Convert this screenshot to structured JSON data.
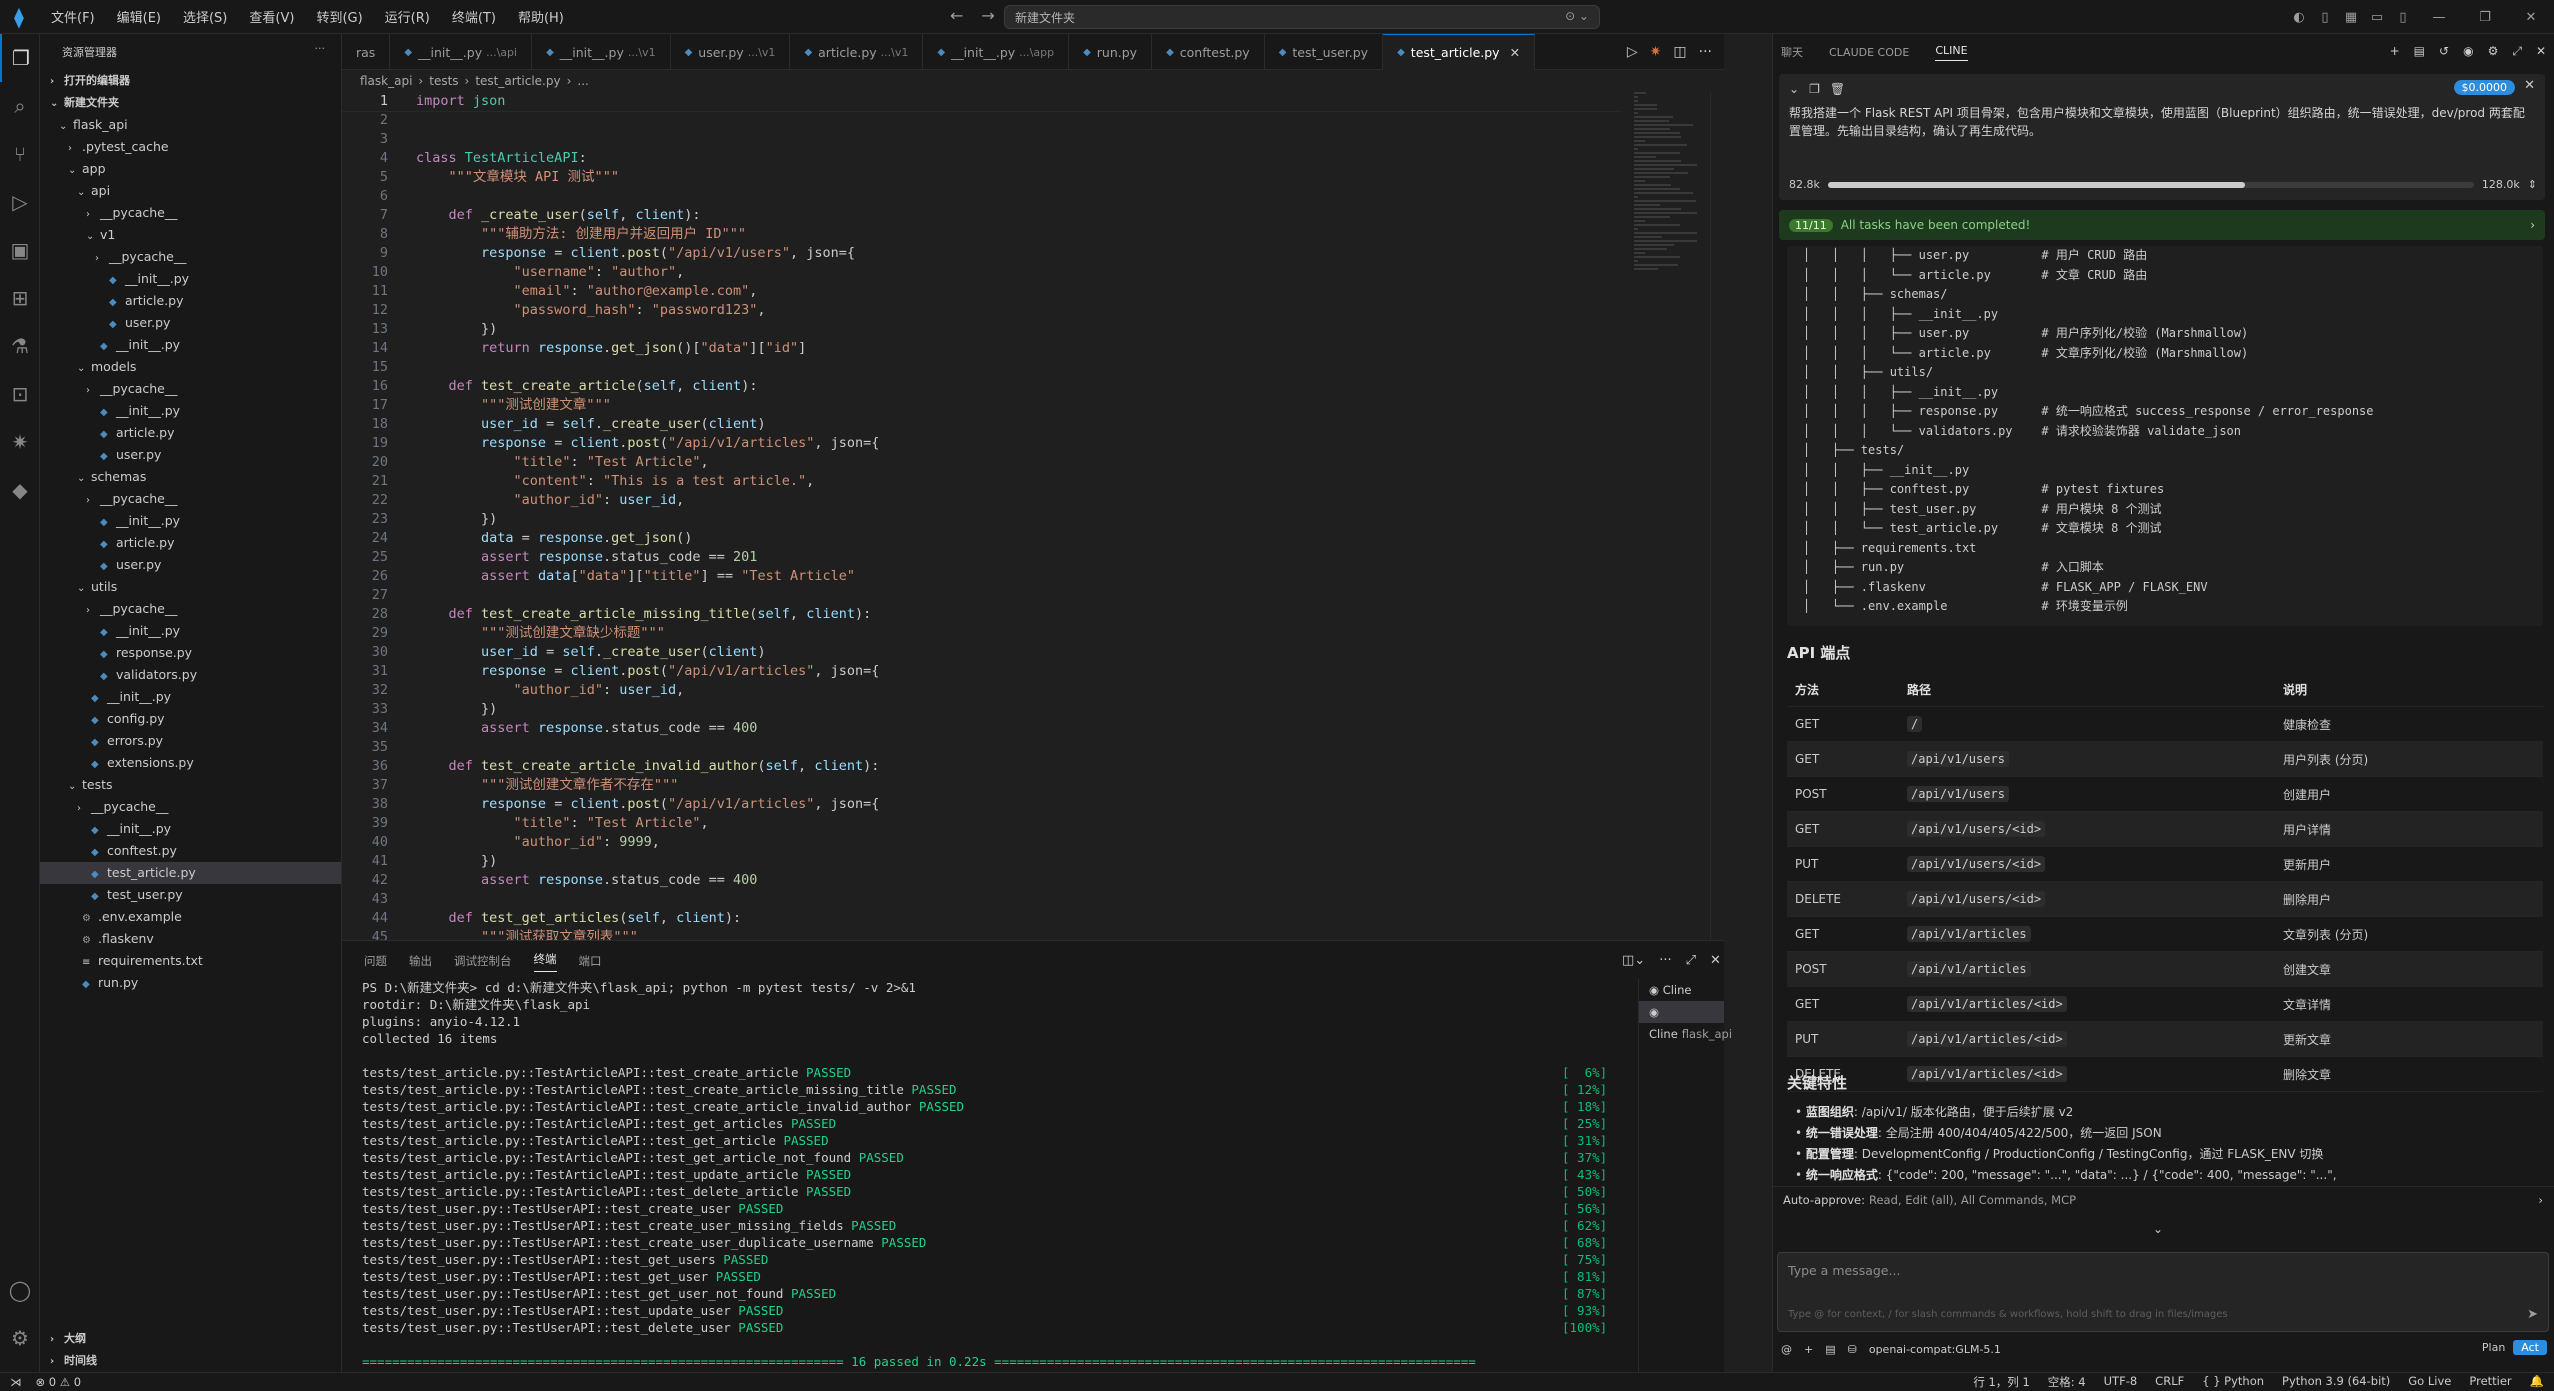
{
  "titlebar": {
    "menu": [
      "文件(F)",
      "编辑(E)",
      "选择(S)",
      "查看(V)",
      "转到(G)",
      "运行(R)",
      "终端(T)",
      "帮助(H)"
    ],
    "search_text": "新建文件夹"
  },
  "sidebar": {
    "title": "资源管理器",
    "open_editors": "打开的编辑器",
    "folder": "新建文件夹",
    "outline": "大纲",
    "timeline": "时间线",
    "tree": [
      {
        "label": "flask_api",
        "depth": 1,
        "type": "folder",
        "open": true
      },
      {
        "label": ".pytest_cache",
        "depth": 2,
        "type": "folder",
        "open": false
      },
      {
        "label": "app",
        "depth": 2,
        "type": "folder",
        "open": true
      },
      {
        "label": "api",
        "depth": 3,
        "type": "folder",
        "open": true
      },
      {
        "label": "__pycache__",
        "depth": 4,
        "type": "folder",
        "open": false
      },
      {
        "label": "v1",
        "depth": 4,
        "type": "folder",
        "open": true
      },
      {
        "label": "__pycache__",
        "depth": 5,
        "type": "folder",
        "open": false
      },
      {
        "label": "__init__.py",
        "depth": 5,
        "type": "py"
      },
      {
        "label": "article.py",
        "depth": 5,
        "type": "py"
      },
      {
        "label": "user.py",
        "depth": 5,
        "type": "py"
      },
      {
        "label": "__init__.py",
        "depth": 4,
        "type": "py"
      },
      {
        "label": "models",
        "depth": 3,
        "type": "folder",
        "open": true
      },
      {
        "label": "__pycache__",
        "depth": 4,
        "type": "folder",
        "open": false
      },
      {
        "label": "__init__.py",
        "depth": 4,
        "type": "py"
      },
      {
        "label": "article.py",
        "depth": 4,
        "type": "py"
      },
      {
        "label": "user.py",
        "depth": 4,
        "type": "py"
      },
      {
        "label": "schemas",
        "depth": 3,
        "type": "folder",
        "open": true
      },
      {
        "label": "__pycache__",
        "depth": 4,
        "type": "folder",
        "open": false
      },
      {
        "label": "__init__.py",
        "depth": 4,
        "type": "py"
      },
      {
        "label": "article.py",
        "depth": 4,
        "type": "py"
      },
      {
        "label": "user.py",
        "depth": 4,
        "type": "py"
      },
      {
        "label": "utils",
        "depth": 3,
        "type": "folder",
        "open": true
      },
      {
        "label": "__pycache__",
        "depth": 4,
        "type": "folder",
        "open": false
      },
      {
        "label": "__init__.py",
        "depth": 4,
        "type": "py"
      },
      {
        "label": "response.py",
        "depth": 4,
        "type": "py"
      },
      {
        "label": "validators.py",
        "depth": 4,
        "type": "py"
      },
      {
        "label": "__init__.py",
        "depth": 3,
        "type": "py"
      },
      {
        "label": "config.py",
        "depth": 3,
        "type": "py"
      },
      {
        "label": "errors.py",
        "depth": 3,
        "type": "py"
      },
      {
        "label": "extensions.py",
        "depth": 3,
        "type": "py"
      },
      {
        "label": "tests",
        "depth": 2,
        "type": "folder",
        "open": true
      },
      {
        "label": "__pycache__",
        "depth": 3,
        "type": "folder",
        "open": false
      },
      {
        "label": "__init__.py",
        "depth": 3,
        "type": "py"
      },
      {
        "label": "conftest.py",
        "depth": 3,
        "type": "py"
      },
      {
        "label": "test_article.py",
        "depth": 3,
        "type": "py",
        "selected": true
      },
      {
        "label": "test_user.py",
        "depth": 3,
        "type": "py"
      },
      {
        "label": ".env.example",
        "depth": 2,
        "type": "gear"
      },
      {
        "label": ".flaskenv",
        "depth": 2,
        "type": "gear"
      },
      {
        "label": "requirements.txt",
        "depth": 2,
        "type": "txt"
      },
      {
        "label": "run.py",
        "depth": 2,
        "type": "py"
      }
    ]
  },
  "editor": {
    "tabs": [
      {
        "label": "ras",
        "sub": ""
      },
      {
        "label": "__init__.py",
        "sub": "...\\api"
      },
      {
        "label": "__init__.py",
        "sub": "...\\v1"
      },
      {
        "label": "user.py",
        "sub": "...\\v1"
      },
      {
        "label": "article.py",
        "sub": "...\\v1"
      },
      {
        "label": "__init__.py",
        "sub": "...\\app"
      },
      {
        "label": "run.py",
        "sub": ""
      },
      {
        "label": "conftest.py",
        "sub": ""
      },
      {
        "label": "test_user.py",
        "sub": ""
      },
      {
        "label": "test_article.py",
        "sub": "",
        "active": true
      }
    ],
    "breadcrumb": [
      "flask_api",
      "tests",
      "test_article.py",
      "..."
    ],
    "code": [
      "import json",
      "",
      "",
      "class TestArticleAPI:",
      "    \"\"\"文章模块 API 测试\"\"\"",
      "",
      "    def _create_user(self, client):",
      "        \"\"\"辅助方法: 创建用户并返回用户 ID\"\"\"",
      "        response = client.post(\"/api/v1/users\", json={",
      "            \"username\": \"author\",",
      "            \"email\": \"author@example.com\",",
      "            \"password_hash\": \"password123\",",
      "        })",
      "        return response.get_json()[\"data\"][\"id\"]",
      "",
      "    def test_create_article(self, client):",
      "        \"\"\"测试创建文章\"\"\"",
      "        user_id = self._create_user(client)",
      "        response = client.post(\"/api/v1/articles\", json={",
      "            \"title\": \"Test Article\",",
      "            \"content\": \"This is a test article.\",",
      "            \"author_id\": user_id,",
      "        })",
      "        data = response.get_json()",
      "        assert response.status_code == 201",
      "        assert data[\"data\"][\"title\"] == \"Test Article\"",
      "",
      "    def test_create_article_missing_title(self, client):",
      "        \"\"\"测试创建文章缺少标题\"\"\"",
      "        user_id = self._create_user(client)",
      "        response = client.post(\"/api/v1/articles\", json={",
      "            \"author_id\": user_id,",
      "        })",
      "        assert response.status_code == 400",
      "",
      "    def test_create_article_invalid_author(self, client):",
      "        \"\"\"测试创建文章作者不存在\"\"\"",
      "        response = client.post(\"/api/v1/articles\", json={",
      "            \"title\": \"Test Article\",",
      "            \"author_id\": 9999,",
      "        })",
      "        assert response.status_code == 400",
      "",
      "    def test_get_articles(self, client):",
      "        \"\"\"测试获取文章列表\"\"\""
    ]
  },
  "panel": {
    "tabs": [
      "问题",
      "输出",
      "调试控制台",
      "终端",
      "端口"
    ],
    "active_tab": "终端",
    "terminals": [
      {
        "label": "Cline",
        "sub": ""
      },
      {
        "label": "Cline",
        "sub": "flask_api"
      }
    ],
    "lines": [
      {
        "text": "PS D:\\新建文件夹> cd d:\\新建文件夹\\flask_api; python -m pytest tests/ -v 2>&1",
        "pct": ""
      },
      {
        "text": "rootdir: D:\\新建文件夹\\flask_api",
        "pct": ""
      },
      {
        "text": "plugins: anyio-4.12.1",
        "pct": ""
      },
      {
        "text": "collected 16 items",
        "pct": ""
      },
      {
        "text": "",
        "pct": ""
      },
      {
        "text": "tests/test_article.py::TestArticleAPI::test_create_article",
        "pass": "PASSED",
        "pct": "[  6%]"
      },
      {
        "text": "tests/test_article.py::TestArticleAPI::test_create_article_missing_title",
        "pass": "PASSED",
        "pct": "[ 12%]"
      },
      {
        "text": "tests/test_article.py::TestArticleAPI::test_create_article_invalid_author",
        "pass": "PASSED",
        "pct": "[ 18%]"
      },
      {
        "text": "tests/test_article.py::TestArticleAPI::test_get_articles",
        "pass": "PASSED",
        "pct": "[ 25%]"
      },
      {
        "text": "tests/test_article.py::TestArticleAPI::test_get_article",
        "pass": "PASSED",
        "pct": "[ 31%]"
      },
      {
        "text": "tests/test_article.py::TestArticleAPI::test_get_article_not_found",
        "pass": "PASSED",
        "pct": "[ 37%]"
      },
      {
        "text": "tests/test_article.py::TestArticleAPI::test_update_article",
        "pass": "PASSED",
        "pct": "[ 43%]"
      },
      {
        "text": "tests/test_article.py::TestArticleAPI::test_delete_article",
        "pass": "PASSED",
        "pct": "[ 50%]"
      },
      {
        "text": "tests/test_user.py::TestUserAPI::test_create_user",
        "pass": "PASSED",
        "pct": "[ 56%]"
      },
      {
        "text": "tests/test_user.py::TestUserAPI::test_create_user_missing_fields",
        "pass": "PASSED",
        "pct": "[ 62%]"
      },
      {
        "text": "tests/test_user.py::TestUserAPI::test_create_user_duplicate_username",
        "pass": "PASSED",
        "pct": "[ 68%]"
      },
      {
        "text": "tests/test_user.py::TestUserAPI::test_get_users",
        "pass": "PASSED",
        "pct": "[ 75%]"
      },
      {
        "text": "tests/test_user.py::TestUserAPI::test_get_user",
        "pass": "PASSED",
        "pct": "[ 81%]"
      },
      {
        "text": "tests/test_user.py::TestUserAPI::test_get_user_not_found",
        "pass": "PASSED",
        "pct": "[ 87%]"
      },
      {
        "text": "tests/test_user.py::TestUserAPI::test_update_user",
        "pass": "PASSED",
        "pct": "[ 93%]"
      },
      {
        "text": "tests/test_user.py::TestUserAPI::test_delete_user",
        "pass": "PASSED",
        "pct": "[100%]"
      },
      {
        "text": "",
        "pct": ""
      },
      {
        "text": "================================================================ 16 passed in 0.22s ================================================================",
        "pct": "",
        "summary": true
      }
    ]
  },
  "rightpanel": {
    "tabs": [
      "聊天",
      "CLAUDE CODE",
      "CLINE"
    ],
    "active_tab": "CLINE",
    "cost": "$0.0000",
    "task_text": "帮我搭建一个 Flask REST API 项目骨架，包含用户模块和文章模块，使用蓝图（Blueprint）组织路由，统一错误处理，dev/prod 两套配置管理。先输出目录结构，确认了再生成代码。",
    "ctx_used": "82.8k",
    "ctx_max": "128.0k",
    "ctx_fraction": 0.646,
    "done_badge": "11/11",
    "done_text": "All tasks have been completed!",
    "tree_lines": [
      "│   │   │   ├── user.py          # 用户 CRUD 路由",
      "│   │   │   └── article.py       # 文章 CRUD 路由",
      "│   │   ├── schemas/",
      "│   │   │   ├── __init__.py",
      "│   │   │   ├── user.py          # 用户序列化/校验 (Marshmallow)",
      "│   │   │   └── article.py       # 文章序列化/校验 (Marshmallow)",
      "│   │   ├── utils/",
      "│   │   │   ├── __init__.py",
      "│   │   │   ├── response.py      # 统一响应格式 success_response / error_response",
      "│   │   │   └── validators.py    # 请求校验装饰器 validate_json",
      "│   ├── tests/",
      "│   │   ├── __init__.py",
      "│   │   ├── conftest.py          # pytest fixtures",
      "│   │   ├── test_user.py         # 用户模块 8 个测试",
      "│   │   └── test_article.py      # 文章模块 8 个测试",
      "│   ├── requirements.txt",
      "│   ├── run.py                   # 入口脚本",
      "│   ├── .flaskenv                # FLASK_APP / FLASK_ENV",
      "│   └── .env.example             # 环境变量示例"
    ],
    "api_title": "API 端点",
    "api_head": [
      "方法",
      "路径",
      "说明"
    ],
    "api_rows": [
      [
        "GET",
        "/",
        "健康检查"
      ],
      [
        "GET",
        "/api/v1/users",
        "用户列表 (分页)"
      ],
      [
        "POST",
        "/api/v1/users",
        "创建用户"
      ],
      [
        "GET",
        "/api/v1/users/<id>",
        "用户详情"
      ],
      [
        "PUT",
        "/api/v1/users/<id>",
        "更新用户"
      ],
      [
        "DELETE",
        "/api/v1/users/<id>",
        "删除用户"
      ],
      [
        "GET",
        "/api/v1/articles",
        "文章列表 (分页)"
      ],
      [
        "POST",
        "/api/v1/articles",
        "创建文章"
      ],
      [
        "GET",
        "/api/v1/articles/<id>",
        "文章详情"
      ],
      [
        "PUT",
        "/api/v1/articles/<id>",
        "更新文章"
      ],
      [
        "DELETE",
        "/api/v1/articles/<id>",
        "删除文章"
      ]
    ],
    "features_title": "关键特性",
    "features": [
      {
        "b": "蓝图组织",
        "t": ": /api/v1/ 版本化路由，便于后续扩展 v2"
      },
      {
        "b": "统一错误处理",
        "t": ": 全局注册 400/404/405/422/500，统一返回 JSON"
      },
      {
        "b": "配置管理",
        "t": ": DevelopmentConfig / ProductionConfig / TestingConfig，通过 FLASK_ENV 切换"
      },
      {
        "b": "统一响应格式",
        "t": ": {\"code\": 200, \"message\": \"...\", \"data\": ...} / {\"code\": 400, \"message\": \"...\","
      }
    ],
    "autoapprove_label": "Auto-approve:",
    "autoapprove_value": "Read, Edit (all), All Commands, MCP",
    "input_placeholder": "Type a message...",
    "input_hint": "Type @ for context, / for slash commands & workflows, hold shift to drag in files/images",
    "model": "openai-compat:GLM-5.1",
    "mode_plan": "Plan",
    "mode_act": "Act"
  },
  "statusbar": {
    "left": [
      "⊗ 0 ⚠ 0"
    ],
    "right": [
      "行 1，列 1",
      "空格: 4",
      "UTF-8",
      "CRLF",
      "{ } Python",
      "Python 3.9 (64-bit)",
      "Go Live",
      "Prettier"
    ]
  }
}
